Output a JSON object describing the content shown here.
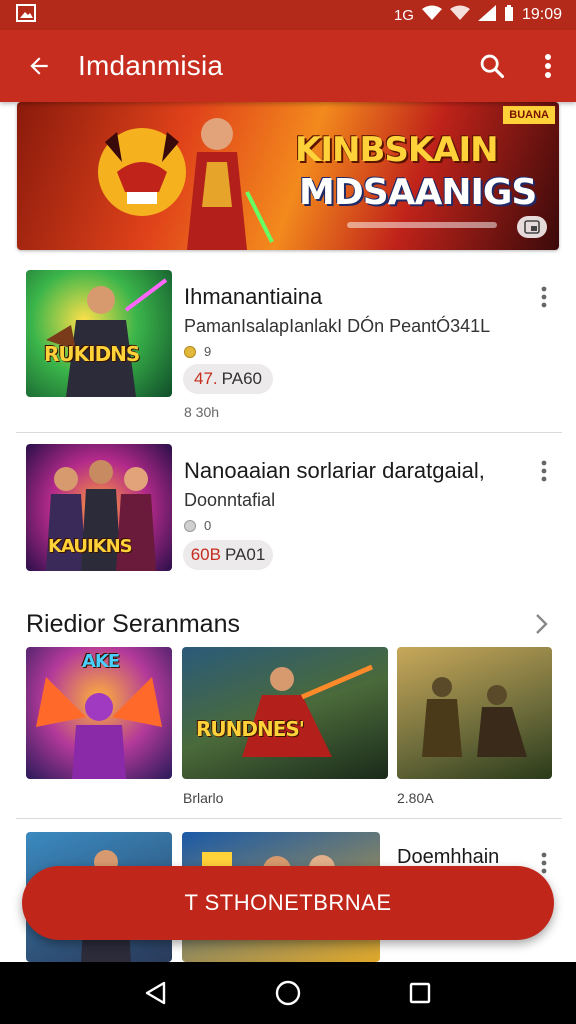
{
  "status_bar": {
    "time": "19:09",
    "network_label": "1G"
  },
  "app_bar": {
    "title": "Imdanmisia"
  },
  "hero": {
    "title_line1": "KINBSKAIN",
    "title_line2": "MDSAANIGS",
    "badge": "BUANA"
  },
  "apps": [
    {
      "title": "Ihmanantiaina",
      "subtitle": "PamanIsalapIanlakI DÓn PeantÓ341L",
      "rating": "9",
      "price_red": "47.",
      "price_rest": "PA60",
      "size": "8 30h",
      "thumb_label": "RUKIDNS"
    },
    {
      "title": "Nanoaaian sorlariar daratgaial,",
      "subtitle": "Doonntafial",
      "rating": "0",
      "price_red": "60B",
      "price_rest": "PA01",
      "thumb_label": "KAUIKNS"
    }
  ],
  "section": {
    "title": "Riedior Seranmans"
  },
  "tiles": [
    {
      "thumb_label": "AKE",
      "caption": ""
    },
    {
      "thumb_label": "RUNDNES'",
      "caption": "Brlarlo"
    },
    {
      "thumb_label": "",
      "caption": "2.80A"
    }
  ],
  "bottom_row": {
    "title": "Doemhhain"
  },
  "fab": {
    "label": "T STHONETBRNAE"
  },
  "colors": {
    "primary": "#c62d1f",
    "status_bar": "#b32a1a",
    "fab": "#c1261a",
    "price_accent": "#c62d1f"
  },
  "icons": {
    "back": "arrow-left-icon",
    "search": "search-icon",
    "more": "more-vert-icon",
    "chevron": "chevron-right-icon",
    "nav_back": "triangle-back-icon",
    "nav_home": "circle-home-icon",
    "nav_recents": "square-recents-icon"
  }
}
